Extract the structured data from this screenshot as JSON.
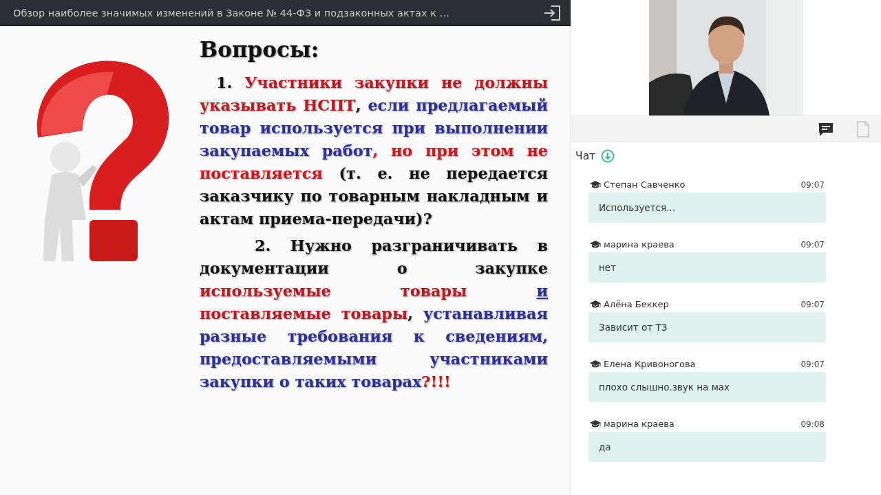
{
  "header": {
    "title": "Обзор наиболее значимых изменений в Законе № 44-ФЗ и подзаконных актах к …"
  },
  "slide": {
    "title": "Вопросы:",
    "paragraphs": [
      {
        "runs": [
          {
            "text": "1. ",
            "color": "#111111",
            "underline": false
          },
          {
            "text": "Участники закупки не должны указывать НСПТ",
            "color": "#c01820",
            "underline": false
          },
          {
            "text": ", ",
            "color": "#111111",
            "underline": false
          },
          {
            "text": "если предлагаемый товар используется при выполнении закупаемых работ",
            "color": "#2b2f96",
            "underline": false
          },
          {
            "text": ", но при этом не поставляется",
            "color": "#d4141c",
            "underline": false
          },
          {
            "text": " (т. е. не передается заказчику по товарным накладным и актам приема-передачи)?",
            "color": "#111111",
            "underline": false
          }
        ]
      },
      {
        "runs": [
          {
            "text": "2. Нужно разграничивать в документации о закупке ",
            "color": "#111111",
            "underline": false
          },
          {
            "text": "используемые товары ",
            "color": "#c01820",
            "underline": false
          },
          {
            "text": "и",
            "color": "#2b2f96",
            "underline": true
          },
          {
            "text": " поставляемые товары",
            "color": "#c01820",
            "underline": false
          },
          {
            "text": ", ",
            "color": "#111111",
            "underline": false
          },
          {
            "text": "устанавливая разные требования к сведениям, предоставляемыми участниками закупки о таких товарах",
            "color": "#2b2f96",
            "underline": false
          },
          {
            "text": "?!!!",
            "color": "#c01820",
            "underline": false
          }
        ]
      }
    ]
  },
  "tabs": [
    {
      "kind": "chat",
      "selected": true
    },
    {
      "kind": "files",
      "selected": false
    }
  ],
  "chat": {
    "title": "Чат",
    "messages": [
      {
        "author": "Степан Савченко",
        "time": "09:07",
        "text": "Используется..."
      },
      {
        "author": "марина краева",
        "time": "09:07",
        "text": "нет"
      },
      {
        "author": "Алёна Беккер",
        "time": "09:07",
        "text": "Зависит от ТЗ"
      },
      {
        "author": "Елена Кривоногова",
        "time": "09:07",
        "text": "плохо слышно.звук на мах"
      },
      {
        "author": "марина краева",
        "time": "09:08",
        "text": "да"
      }
    ]
  }
}
